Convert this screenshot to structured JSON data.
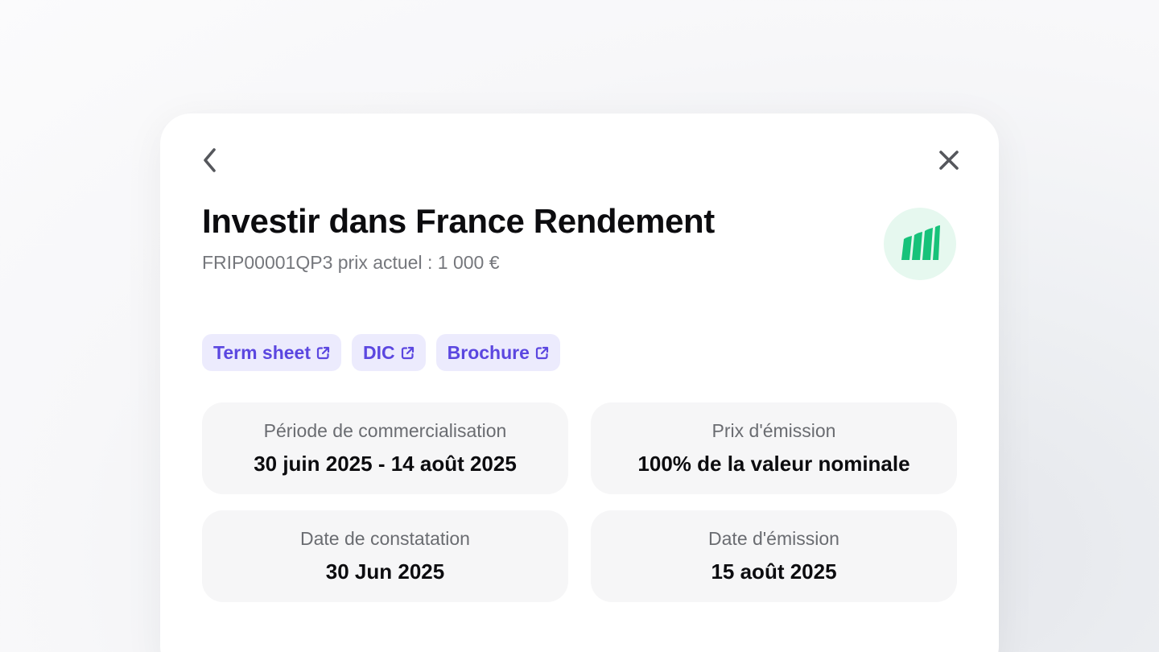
{
  "header": {
    "title": "Investir dans France Rendement",
    "subtitle": "FRIP00001QP3 prix actuel : 1 000 €"
  },
  "icons": {
    "back": "chevron-left-icon",
    "close": "close-icon",
    "logo": "product-logo-icon",
    "external": "external-link-icon"
  },
  "colors": {
    "accent": "#5b47e0",
    "chip_bg": "#ecebfd",
    "logo_green": "#17c27a",
    "logo_bg": "#e6f8ef",
    "card_bg": "#f6f6f7"
  },
  "documents": [
    {
      "label": "Term sheet"
    },
    {
      "label": "DIC"
    },
    {
      "label": "Brochure"
    }
  ],
  "details": [
    {
      "label": "Période de commercialisation",
      "value": "30 juin 2025 - 14 août 2025"
    },
    {
      "label": "Prix d'émission",
      "value": "100% de la valeur nominale"
    },
    {
      "label": "Date de constatation",
      "value": "30 Jun 2025"
    },
    {
      "label": "Date d'émission",
      "value": "15 août 2025"
    }
  ]
}
